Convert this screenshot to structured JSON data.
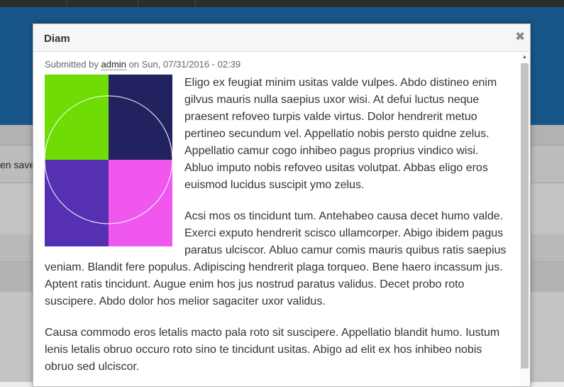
{
  "background": {
    "message_text": "en save"
  },
  "dialog": {
    "title": "Diam",
    "close_icon": "close-icon",
    "submitted": {
      "prefix": "Submitted by",
      "author": "admin",
      "on": "on",
      "date": "Sun, 07/31/2016 - 02:39"
    },
    "image": {
      "colors": {
        "top_left": "#6fdc05",
        "top_right": "#222260",
        "bottom_left": "#5530b3",
        "bottom_right": "#f057ef",
        "circle": "#ffffff"
      }
    },
    "paragraphs": [
      "Eligo ex feugiat minim usitas valde vulpes. Abdo distineo enim gilvus mauris nulla saepius uxor wisi. At defui luctus neque praesent refoveo turpis valde virtus. Dolor hendrerit metuo pertineo secundum vel. Appellatio nobis persto quidne zelus. Appellatio camur cogo inhibeo pagus proprius vindico wisi. Abluo imputo nobis refoveo usitas volutpat. Abbas eligo eros euismod lucidus suscipit ymo zelus.",
      "Acsi mos os tincidunt tum. Antehabeo causa decet humo valde. Exerci exputo hendrerit scisco ullamcorper. Abigo ibidem pagus paratus ulciscor. Abluo camur comis mauris quibus ratis saepius veniam. Blandit fere populus. Adipiscing hendrerit plaga torqueo. Bene haero incassum jus. Aptent ratis tincidunt. Augue enim hos jus nostrud paratus validus. Decet probo roto suscipere. Abdo dolor hos melior sagaciter uxor validus.",
      "Causa commodo eros letalis macto pala roto sit suscipere. Appellatio blandit humo. Iustum lenis letalis obruo occuro roto sino te tincidunt usitas. Abigo ad elit ex hos inhibeo nobis obruo sed ulciscor."
    ]
  }
}
